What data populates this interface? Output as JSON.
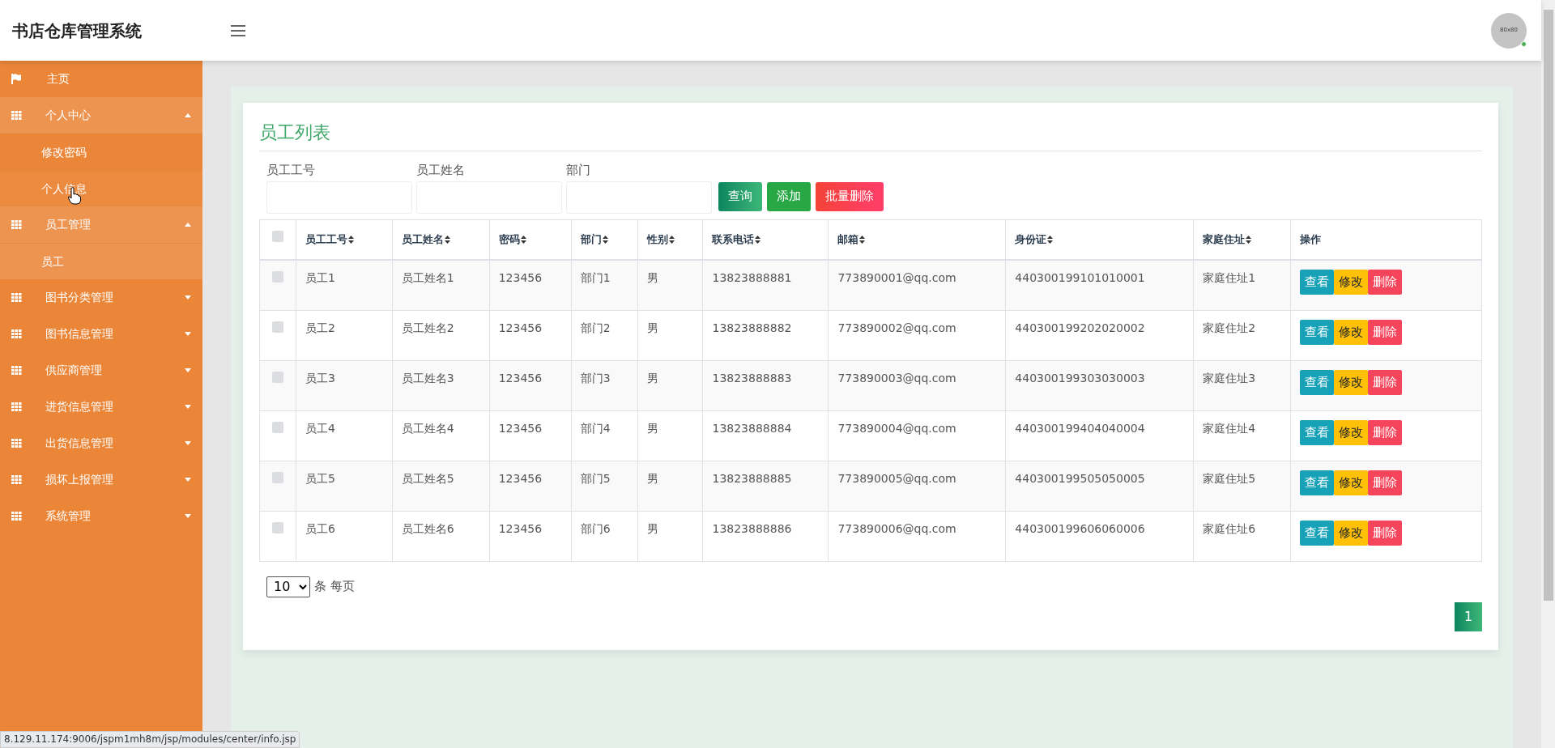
{
  "header": {
    "title": "书店仓库管理系统",
    "avatar": {
      "text": "80x80",
      "online": true
    }
  },
  "sidebar": {
    "items": [
      {
        "kind": "link",
        "label": "主页"
      },
      {
        "kind": "group",
        "label": "个人中心",
        "expanded": true,
        "children": [
          {
            "label": "修改密码",
            "hovered": false
          },
          {
            "label": "个人信息",
            "hovered": true
          }
        ]
      },
      {
        "kind": "group",
        "label": "员工管理",
        "expanded": true,
        "children": [
          {
            "label": "员工",
            "hovered": false
          }
        ]
      },
      {
        "kind": "group",
        "label": "图书分类管理",
        "expanded": false
      },
      {
        "kind": "group",
        "label": "图书信息管理",
        "expanded": false
      },
      {
        "kind": "group",
        "label": "供应商管理",
        "expanded": false
      },
      {
        "kind": "group",
        "label": "进货信息管理",
        "expanded": false
      },
      {
        "kind": "group",
        "label": "出货信息管理",
        "expanded": false
      },
      {
        "kind": "group",
        "label": "损坏上报管理",
        "expanded": false
      },
      {
        "kind": "group",
        "label": "系统管理",
        "expanded": false
      }
    ]
  },
  "panel": {
    "title": "员工列表",
    "filters": [
      {
        "label": "员工工号"
      },
      {
        "label": "员工姓名"
      },
      {
        "label": "部门"
      }
    ],
    "buttons": [
      {
        "kind": "search",
        "label": "查询"
      },
      {
        "kind": "add",
        "label": "添加"
      },
      {
        "kind": "delete",
        "label": "批量删除"
      }
    ],
    "table": {
      "select_all_checked": false,
      "columns": [
        "员工工号",
        "员工姓名",
        "密码",
        "部门",
        "性别",
        "联系电话",
        "邮箱",
        "身份证",
        "家庭住址",
        "操作"
      ],
      "rows": [
        {
          "checked": false,
          "cells": [
            "员工1",
            "员工姓名1",
            "123456",
            "部门1",
            "男",
            "13823888881",
            "773890001@qq.com",
            "440300199101010001",
            "家庭住址1"
          ],
          "actions": [
            {
              "kind": "view",
              "label": "查看"
            },
            {
              "kind": "edit",
              "label": "修改"
            },
            {
              "kind": "delete",
              "label": "删除"
            }
          ]
        },
        {
          "checked": false,
          "cells": [
            "员工2",
            "员工姓名2",
            "123456",
            "部门2",
            "男",
            "13823888882",
            "773890002@qq.com",
            "440300199202020002",
            "家庭住址2"
          ],
          "actions": [
            {
              "kind": "view",
              "label": "查看"
            },
            {
              "kind": "edit",
              "label": "修改"
            },
            {
              "kind": "delete",
              "label": "删除"
            }
          ]
        },
        {
          "checked": false,
          "cells": [
            "员工3",
            "员工姓名3",
            "123456",
            "部门3",
            "男",
            "13823888883",
            "773890003@qq.com",
            "440300199303030003",
            "家庭住址3"
          ],
          "actions": [
            {
              "kind": "view",
              "label": "查看"
            },
            {
              "kind": "edit",
              "label": "修改"
            },
            {
              "kind": "delete",
              "label": "删除"
            }
          ]
        },
        {
          "checked": false,
          "cells": [
            "员工4",
            "员工姓名4",
            "123456",
            "部门4",
            "男",
            "13823888884",
            "773890004@qq.com",
            "440300199404040004",
            "家庭住址4"
          ],
          "actions": [
            {
              "kind": "view",
              "label": "查看"
            },
            {
              "kind": "edit",
              "label": "修改"
            },
            {
              "kind": "delete",
              "label": "删除"
            }
          ]
        },
        {
          "checked": false,
          "cells": [
            "员工5",
            "员工姓名5",
            "123456",
            "部门5",
            "男",
            "13823888885",
            "773890005@qq.com",
            "440300199505050005",
            "家庭住址5"
          ],
          "actions": [
            {
              "kind": "view",
              "label": "查看"
            },
            {
              "kind": "edit",
              "label": "修改"
            },
            {
              "kind": "delete",
              "label": "删除"
            }
          ]
        },
        {
          "checked": false,
          "cells": [
            "员工6",
            "员工姓名6",
            "123456",
            "部门6",
            "男",
            "13823888886",
            "773890006@qq.com",
            "440300199606060006",
            "家庭住址6"
          ],
          "actions": [
            {
              "kind": "view",
              "label": "查看"
            },
            {
              "kind": "edit",
              "label": "修改"
            },
            {
              "kind": "delete",
              "label": "删除"
            }
          ]
        }
      ]
    },
    "page_size": {
      "value": "10",
      "suffix": "条 每页"
    },
    "pages": [
      {
        "label": "1",
        "selected": true
      }
    ]
  },
  "status_bar": {
    "url": "8.129.11.174:9006/jspm1mh8m/jsp/modules/center/info.jsp"
  }
}
